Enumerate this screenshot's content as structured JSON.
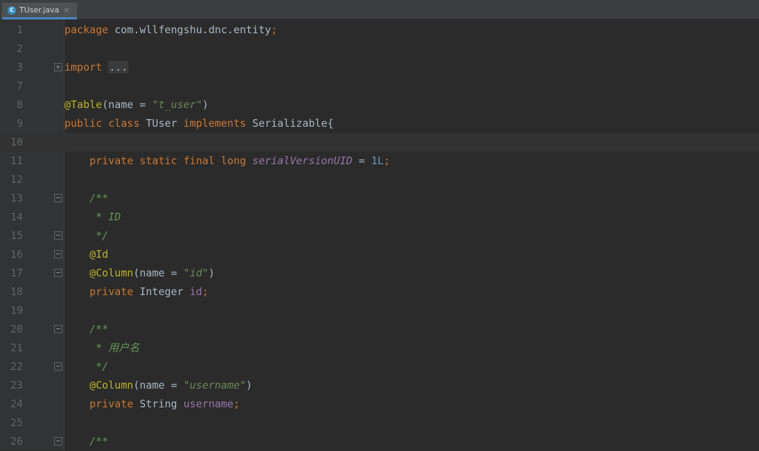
{
  "tab": {
    "file_name": "TUser.java",
    "icon": "class-icon",
    "icon_letter": "C",
    "close_glyph": "×"
  },
  "lines": {
    "n1": "1",
    "n2": "2",
    "n3": "3",
    "n7": "7",
    "n8": "8",
    "n9": "9",
    "n10": "10",
    "n11": "11",
    "n12": "12",
    "n13": "13",
    "n14": "14",
    "n15": "15",
    "n16": "16",
    "n17": "17",
    "n18": "18",
    "n19": "19",
    "n20": "20",
    "n21": "21",
    "n22": "22",
    "n23": "23",
    "n24": "24",
    "n25": "25",
    "n26": "26"
  },
  "code": {
    "l1_kw": "package",
    "l1_pkg": " com.wllfengshu.dnc.entity",
    "l1_semi": ";",
    "l3_kw": "import",
    "l3_folded": "...",
    "l8_ann": "@Table",
    "l8_open": "(name = ",
    "l8_str": "\"t_user\"",
    "l8_close": ")",
    "l9_kw1": "public",
    "l9_kw2": "class",
    "l9_name": "TUser",
    "l9_kw3": "implements",
    "l9_iface": "Serializable{",
    "l11_kw": "private static final long",
    "l11_field": "serialVersionUID",
    "l11_eq": " = ",
    "l11_num": "1L",
    "l11_semi": ";",
    "l13_doc": "/**",
    "l14_doc": " * ID",
    "l15_doc": " */",
    "l16_ann": "@Id",
    "l17_ann": "@Column",
    "l17_open": "(name = ",
    "l17_str": "\"id\"",
    "l17_close": ")",
    "l18_kw": "private",
    "l18_type": " Integer ",
    "l18_field": "id",
    "l18_semi": ";",
    "l20_doc": "/**",
    "l21_doc": " * 用户名",
    "l22_doc": " */",
    "l23_ann": "@Column",
    "l23_open": "(name = ",
    "l23_str": "\"username\"",
    "l23_close": ")",
    "l24_kw": "private",
    "l24_type": " String ",
    "l24_field": "username",
    "l24_semi": ";",
    "l26_doc": "/**"
  },
  "colors": {
    "background": "#2b2b2b",
    "keyword": "#cc7832",
    "annotation": "#bbb529",
    "string": "#6a8759",
    "field": "#9876aa",
    "number": "#6897bb",
    "doc_comment": "#629755"
  }
}
